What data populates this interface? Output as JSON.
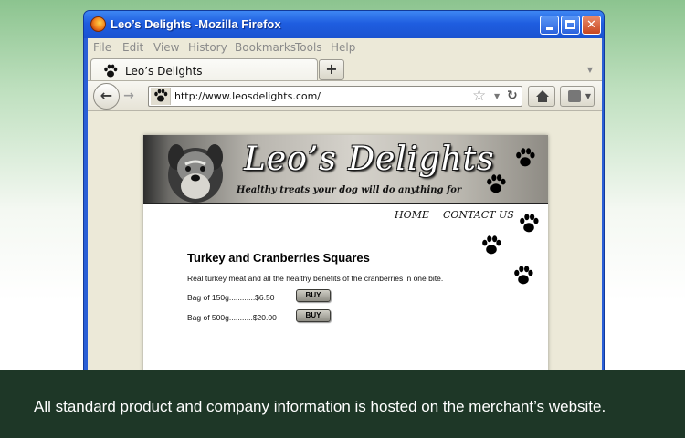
{
  "window": {
    "title": "Leo’s Delights -Mozilla Firefox"
  },
  "menu": [
    "File",
    "Edit",
    "View",
    "History",
    "Bookmarks",
    "Tools",
    "Help"
  ],
  "tab": {
    "label": "Leo’s Delights",
    "new_tab_label": "+"
  },
  "navbar": {
    "back_glyph": "←",
    "forward_glyph": "→",
    "url": "http://www.leosdelights.com/",
    "star_glyph": "☆",
    "reload_glyph": "↻"
  },
  "site": {
    "name": "Leo’s Delights",
    "tagline": "Healthy treats your dog will do anything for",
    "nav": [
      "HOME",
      "CONTACT US"
    ]
  },
  "product": {
    "title": "Turkey and Cranberries Squares",
    "description": "Real turkey meat and all the healthy benefits of the cranberries in one bite.",
    "options": [
      {
        "line": "Bag of 150g............$6.50",
        "button": "BUY"
      },
      {
        "line": "Bag of 500g...........$20.00",
        "button": "BUY"
      }
    ]
  },
  "caption": "All standard product and company information is hosted on the merchant’s website.",
  "colors": {
    "titlebar": "#1f5ee0",
    "chrome": "#ece9d8",
    "caption_bar": "#1e3727",
    "background_top": "#8cc48f"
  }
}
